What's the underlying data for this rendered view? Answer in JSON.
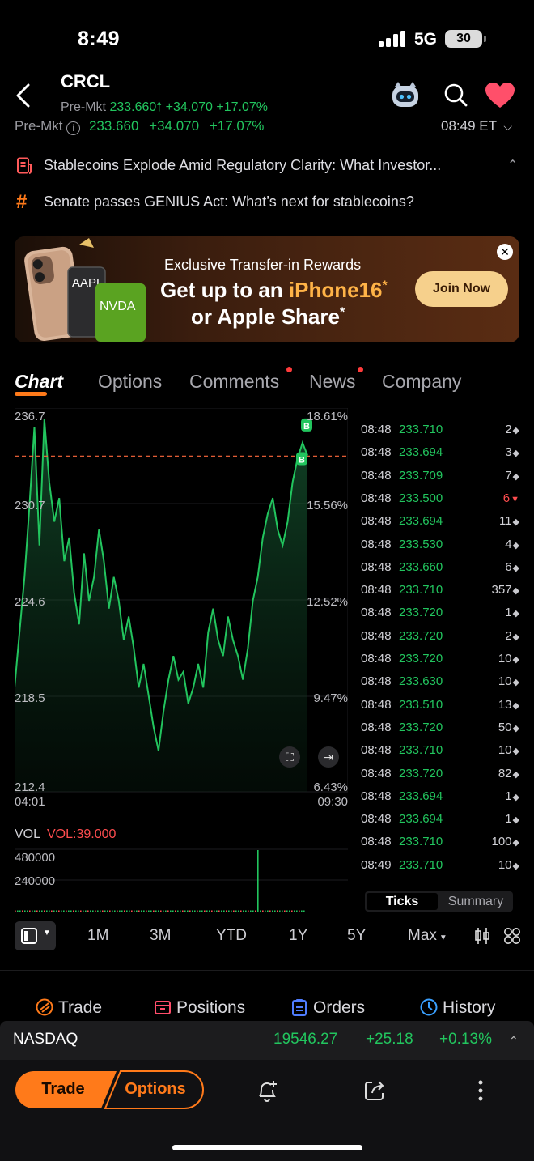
{
  "status_bar": {
    "time": "8:49",
    "network": "5G",
    "battery": "30"
  },
  "header": {
    "ticker": "CRCL",
    "sub_label": "Pre-Mkt",
    "sub_price": "233.660",
    "sub_change": "+34.070",
    "sub_pct": "+17.07%"
  },
  "premarket": {
    "label": "Pre-Mkt",
    "price": "233.660",
    "change": "+34.070",
    "pct": "+17.07%",
    "time": "08:49 ET"
  },
  "news": [
    {
      "text": "Stablecoins Explode Amid Regulatory Clarity: What Investor..."
    },
    {
      "text": "Senate passes GENIUS Act: What’s next for stablecoins?"
    }
  ],
  "banner": {
    "line1": "Exclusive Transfer-in Rewards",
    "line2a": "Get up to an ",
    "line2b": "iPhone16",
    "line2c": "*",
    "line3": "or Apple Share",
    "line3b": "*",
    "cta": "Join Now",
    "card_aapl": "AAPL",
    "card_nvda": "NVDA"
  },
  "tabs": [
    "Chart",
    "Options",
    "Comments",
    "News",
    "Company"
  ],
  "chart": {
    "y_left": [
      "236.7",
      "230.7",
      "224.6",
      "218.5",
      "212.4"
    ],
    "y_right": [
      "18.61%",
      "15.56%",
      "12.52%",
      "9.47%",
      "6.43%"
    ],
    "x_start": "04:01",
    "x_end": "09:30",
    "marker": "B",
    "vol_label": "VOL",
    "vol_value": "VOL:39.000",
    "vol_ticks": [
      "480000",
      "240000"
    ]
  },
  "chart_data": {
    "type": "line",
    "ylim": [
      212.4,
      236.7
    ],
    "x_range": [
      "04:01",
      "09:30"
    ],
    "reference_line": 233.66,
    "series": [
      {
        "values": [
          219.0,
          222.5,
          226.0,
          230.5,
          235.5,
          228.0,
          236.0,
          232.0,
          229.5,
          231.0,
          227.0,
          228.5,
          225.0,
          223.0,
          227.5,
          224.5,
          226.0,
          229.0,
          227.0,
          224.0,
          226.0,
          224.5,
          222.0,
          223.5,
          221.5,
          219.0,
          220.5,
          218.5,
          216.5,
          215.0,
          217.5,
          219.5,
          221.0,
          219.5,
          220.0,
          218.0,
          219.0,
          220.5,
          219.0,
          222.5,
          224.0,
          222.0,
          221.0,
          223.5,
          222.0,
          221.0,
          219.5,
          221.5,
          224.5,
          226.0,
          228.5,
          230.0,
          231.0,
          229.0,
          228.0,
          229.5,
          232.0,
          233.5,
          234.5,
          233.7
        ]
      }
    ],
    "volume": {
      "ylim": [
        0,
        480000
      ],
      "spike": 480000
    }
  },
  "ticks": {
    "rows": [
      {
        "time": "08:48",
        "price": "233.710",
        "vol": "2",
        "dir": "flat"
      },
      {
        "time": "08:48",
        "price": "233.694",
        "vol": "3",
        "dir": "flat"
      },
      {
        "time": "08:48",
        "price": "233.709",
        "vol": "7",
        "dir": "flat"
      },
      {
        "time": "08:48",
        "price": "233.500",
        "vol": "6",
        "dir": "down"
      },
      {
        "time": "08:48",
        "price": "233.694",
        "vol": "11",
        "dir": "flat"
      },
      {
        "time": "08:48",
        "price": "233.530",
        "vol": "4",
        "dir": "flat"
      },
      {
        "time": "08:48",
        "price": "233.660",
        "vol": "6",
        "dir": "flat"
      },
      {
        "time": "08:48",
        "price": "233.710",
        "vol": "357",
        "dir": "flat"
      },
      {
        "time": "08:48",
        "price": "233.720",
        "vol": "1",
        "dir": "flat"
      },
      {
        "time": "08:48",
        "price": "233.720",
        "vol": "2",
        "dir": "flat"
      },
      {
        "time": "08:48",
        "price": "233.720",
        "vol": "10",
        "dir": "flat"
      },
      {
        "time": "08:48",
        "price": "233.630",
        "vol": "10",
        "dir": "flat"
      },
      {
        "time": "08:48",
        "price": "233.510",
        "vol": "13",
        "dir": "flat"
      },
      {
        "time": "08:48",
        "price": "233.720",
        "vol": "50",
        "dir": "flat"
      },
      {
        "time": "08:48",
        "price": "233.710",
        "vol": "10",
        "dir": "flat"
      },
      {
        "time": "08:48",
        "price": "233.720",
        "vol": "82",
        "dir": "flat"
      },
      {
        "time": "08:48",
        "price": "233.694",
        "vol": "1",
        "dir": "flat"
      },
      {
        "time": "08:48",
        "price": "233.694",
        "vol": "1",
        "dir": "flat"
      },
      {
        "time": "08:48",
        "price": "233.710",
        "vol": "100",
        "dir": "flat"
      },
      {
        "time": "08:49",
        "price": "233.710",
        "vol": "10",
        "dir": "flat"
      }
    ],
    "tab_ticks": "Ticks",
    "tab_summary": "Summary"
  },
  "ranges": [
    "1M",
    "3M",
    "YTD",
    "1Y",
    "5Y",
    "Max"
  ],
  "bottom_tabs": {
    "trade": "Trade",
    "positions": "Positions",
    "orders": "Orders",
    "history": "History"
  },
  "index_bar": {
    "name": "NASDAQ",
    "value": "19546.27",
    "change": "+25.18",
    "pct": "+0.13%"
  },
  "action_bar": {
    "trade": "Trade",
    "options": "Options"
  },
  "colors": {
    "accent": "#ff7a1a",
    "up": "#22c55e",
    "down": "#ff4d4f",
    "background": "#000000"
  }
}
